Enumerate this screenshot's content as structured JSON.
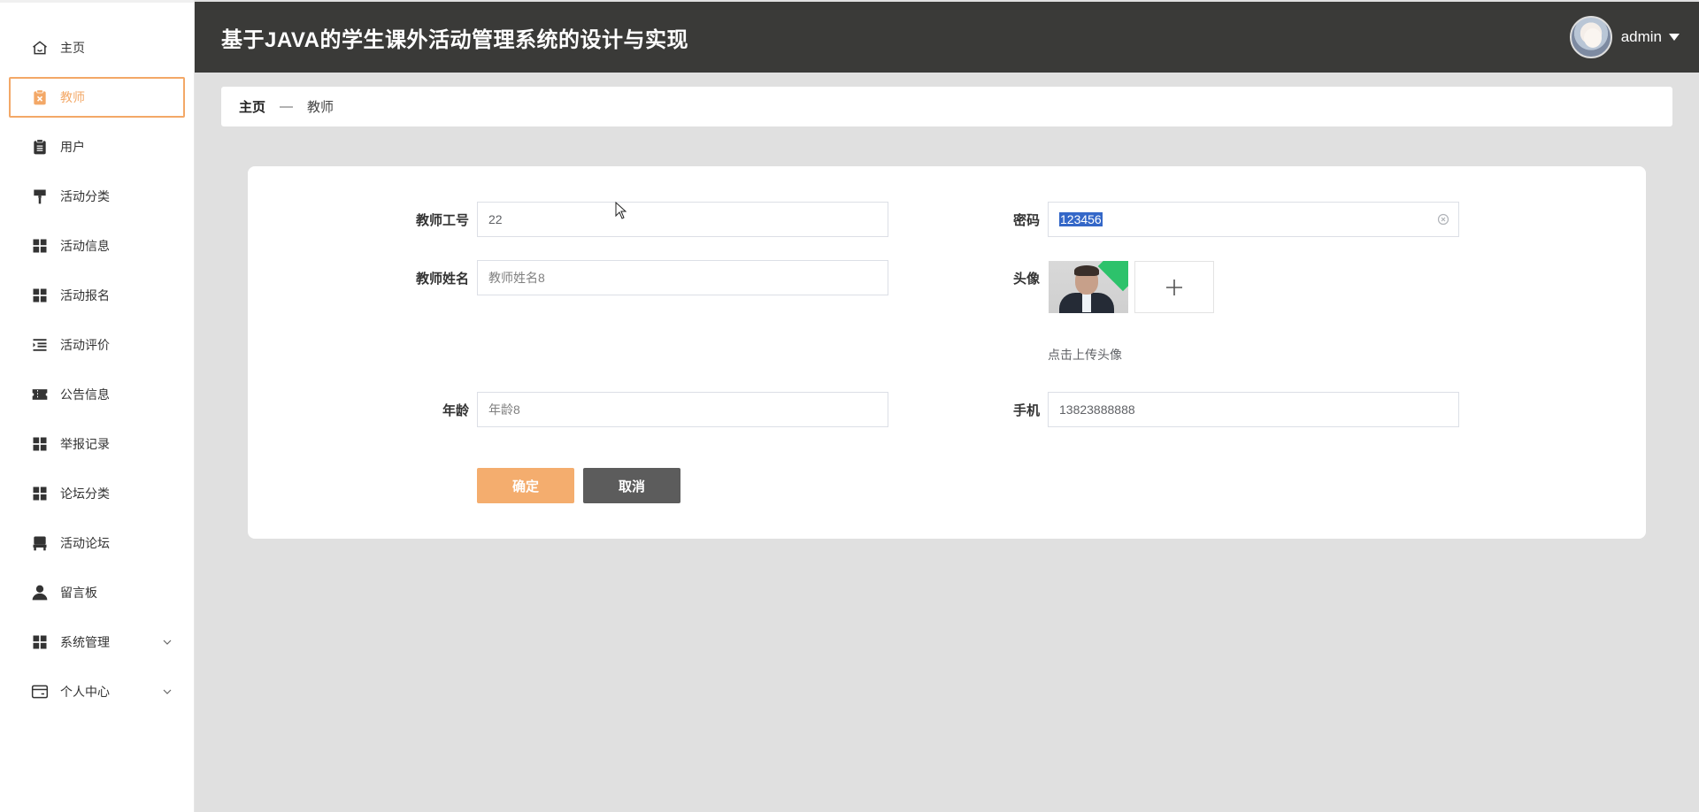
{
  "app": {
    "title": "基于JAVA的学生课外活动管理系统的设计与实现",
    "user": "admin"
  },
  "sidebar": {
    "items": [
      {
        "label": "主页",
        "icon": "home-icon"
      },
      {
        "label": "教师",
        "icon": "clipboard-x-icon",
        "active": true
      },
      {
        "label": "用户",
        "icon": "clipboard-icon"
      },
      {
        "label": "活动分类",
        "icon": "paint-roller-icon"
      },
      {
        "label": "活动信息",
        "icon": "grid-icon"
      },
      {
        "label": "活动报名",
        "icon": "grid-icon"
      },
      {
        "label": "活动评价",
        "icon": "list-indent-icon"
      },
      {
        "label": "公告信息",
        "icon": "ticket-icon"
      },
      {
        "label": "举报记录",
        "icon": "grid-icon"
      },
      {
        "label": "论坛分类",
        "icon": "grid-icon"
      },
      {
        "label": "活动论坛",
        "icon": "chair-icon"
      },
      {
        "label": "留言板",
        "icon": "user-icon"
      },
      {
        "label": "系统管理",
        "icon": "grid-icon",
        "expandable": true
      },
      {
        "label": "个人中心",
        "icon": "card-icon",
        "expandable": true
      }
    ]
  },
  "breadcrumb": {
    "home": "主页",
    "separator": "—",
    "current": "教师"
  },
  "form": {
    "teacher_no": {
      "label": "教师工号",
      "value": "22"
    },
    "password": {
      "label": "密码",
      "value": "123456"
    },
    "teacher_name": {
      "label": "教师姓名",
      "placeholder": "教师姓名8"
    },
    "avatar": {
      "label": "头像",
      "hint": "点击上传头像"
    },
    "age": {
      "label": "年龄",
      "placeholder": "年龄8"
    },
    "phone": {
      "label": "手机",
      "value": "13823888888"
    },
    "confirm_label": "确定",
    "cancel_label": "取消"
  },
  "colors": {
    "accent": "#f3a867",
    "header_bg": "#3a3a38",
    "cancel_bg": "#5c5c5c",
    "confirm_bg": "#f4ad6e",
    "page_bg": "#e0e0e0"
  }
}
